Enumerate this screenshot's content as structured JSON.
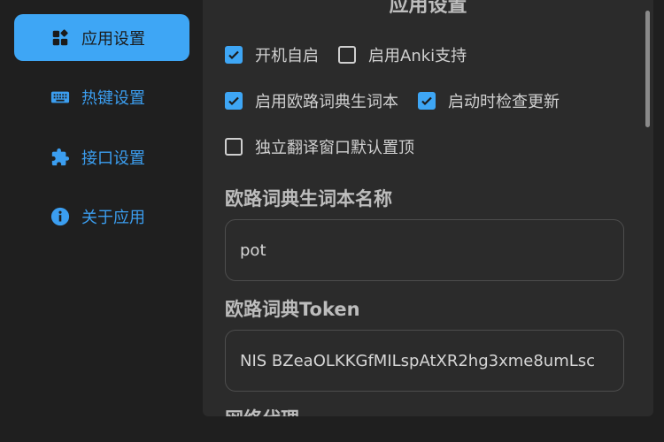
{
  "sidebar": {
    "items": [
      {
        "label": "应用设置",
        "icon": "widgets-icon",
        "active": true
      },
      {
        "label": "热键设置",
        "icon": "keyboard-icon",
        "active": false
      },
      {
        "label": "接口设置",
        "icon": "puzzle-icon",
        "active": false
      },
      {
        "label": "关于应用",
        "icon": "info-icon",
        "active": false
      }
    ]
  },
  "main": {
    "title": "应用设置",
    "checkboxes": [
      {
        "label": "开机自启",
        "checked": true
      },
      {
        "label": "启用Anki支持",
        "checked": false
      },
      {
        "label": "启用欧路词典生词本",
        "checked": true
      },
      {
        "label": "启动时检查更新",
        "checked": true
      },
      {
        "label": "独立翻译窗口默认置顶",
        "checked": false
      }
    ],
    "eudic_name": {
      "label": "欧路词典生词本名称",
      "value": "pot"
    },
    "eudic_token": {
      "label": "欧路词典Token",
      "value": "NIS BZeaOLKKGfMILspAtXR2hg3xme8umLsc"
    },
    "proxy": {
      "label": "网络代理"
    }
  },
  "colors": {
    "accent": "#3ea6f5",
    "background": "#1f1f1f",
    "panel": "#2b2b2b"
  }
}
